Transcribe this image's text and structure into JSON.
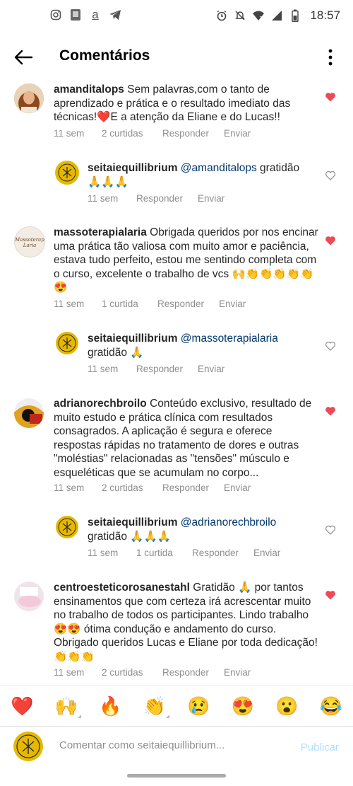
{
  "status_bar": {
    "time": "18:57",
    "left_icons": [
      "instagram-icon",
      "app-icon",
      "amazon-icon",
      "telegram-icon"
    ],
    "right_icons": [
      "alarm-icon",
      "mute-icon",
      "wifi-icon",
      "signal-icon",
      "battery-icon"
    ],
    "amazon_glyph": "a"
  },
  "header": {
    "title": "Comentários"
  },
  "comments": [
    {
      "user": "amanditalops",
      "text": "Sem palavras,com o tanto de aprendizado e prática e o resultado imediato das técnicas!❤️E a atenção da Eliane e do Lucas!!",
      "time": "11 sem",
      "likes": "2 curtidas",
      "reply": "Responder",
      "send": "Enviar",
      "liked": true,
      "reply_item": {
        "user": "seitaiequillibrium",
        "mention": "@amanditalops",
        "text": "gratidão 🙏🙏🙏",
        "time": "11 sem",
        "likes": "",
        "reply": "Responder",
        "send": "Enviar",
        "liked": false
      }
    },
    {
      "user": "massoterapialaria",
      "text": "Obrigada queridos por nos encinar uma prática tão valiosa com muito amor e paciência, estava tudo perfeito, estou me sentindo completa com o curso, excelente o trabalho de vcs 🙌👏👏👏👏👏😍",
      "time": "11 sem",
      "likes": "1 curtida",
      "reply": "Responder",
      "send": "Enviar",
      "liked": true,
      "avatar_text": "Massoterapia Laria",
      "reply_item": {
        "user": "seitaiequillibrium",
        "mention": "@massoterapialaria",
        "text": "gratidão 🙏",
        "time": "11 sem",
        "likes": "",
        "reply": "Responder",
        "send": "Enviar",
        "liked": false
      }
    },
    {
      "user": "adrianorechbroilo",
      "text": "Conteúdo exclusivo, resultado de muito estudo e prática clínica com resultados consagrados. A aplicação é segura e oferece respostas rápidas no tratamento de dores e outras \"moléstias\" relacionadas as \"tensões\" músculo e esqueléticas que se acumulam no corpo...",
      "time": "11 sem",
      "likes": "2 curtidas",
      "reply": "Responder",
      "send": "Enviar",
      "liked": true,
      "reply_item": {
        "user": "seitaiequillibrium",
        "mention": "@adrianorechbroilo",
        "text": "gratidão 🙏🙏🙏",
        "time": "11 sem",
        "likes": "1 curtida",
        "reply": "Responder",
        "send": "Enviar",
        "liked": false
      }
    },
    {
      "user": "centroesteticorosanestahl",
      "text": "Gratidão 🙏 por tantos ensinamentos que com certeza irá acrescentar muito no trabalho de todos os participantes. Lindo trabalho 😍😍 ótima condução e andamento do curso. Obrigado queridos Lucas e Eliane por toda dedicação! 👏👏👏",
      "time": "11 sem",
      "likes": "2 curtidas",
      "reply": "Responder",
      "send": "Enviar",
      "liked": true
    }
  ],
  "emoji_bar": [
    "❤️",
    "🙌",
    "🔥",
    "👏",
    "😢",
    "😍",
    "😮",
    "😂"
  ],
  "comment_input": {
    "placeholder": "Comentar como seitaiequillibrium...",
    "publish": "Publicar"
  },
  "colors": {
    "heart_red": "#ed4956",
    "link_blue": "#00376b",
    "publish_blue": "#b2dffc",
    "gold": "#e6b800"
  }
}
